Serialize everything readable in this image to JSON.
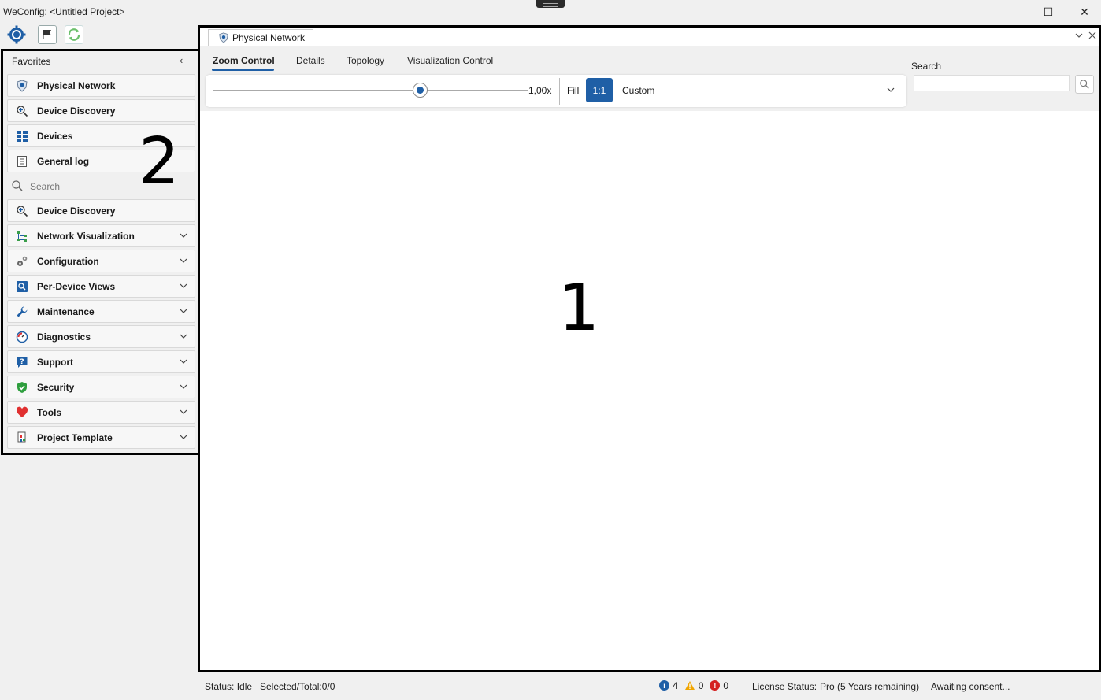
{
  "window": {
    "title": "WeConfig: <Untitled Project>",
    "min": "—",
    "max": "☐",
    "close": "✕"
  },
  "sidebar": {
    "favorites_header": "Favorites",
    "collapse": "‹",
    "favorites": [
      {
        "label": "Physical Network",
        "icon": "physical-network-icon"
      },
      {
        "label": "Device Discovery",
        "icon": "device-discovery-icon"
      },
      {
        "label": "Devices",
        "icon": "devices-icon"
      },
      {
        "label": "General log",
        "icon": "general-log-icon"
      }
    ],
    "search_placeholder": "Search",
    "sections": [
      {
        "label": "Device Discovery",
        "icon": "device-discovery-icon",
        "expandable": false
      },
      {
        "label": "Network Visualization",
        "icon": "network-visualization-icon",
        "expandable": true
      },
      {
        "label": "Configuration",
        "icon": "gears-icon",
        "expandable": true
      },
      {
        "label": "Per-Device Views",
        "icon": "per-device-views-icon",
        "expandable": true
      },
      {
        "label": "Maintenance",
        "icon": "wrench-icon",
        "expandable": true
      },
      {
        "label": "Diagnostics",
        "icon": "gauge-icon",
        "expandable": true
      },
      {
        "label": "Support",
        "icon": "help-icon",
        "expandable": true
      },
      {
        "label": "Security",
        "icon": "shield-icon",
        "expandable": true
      },
      {
        "label": "Tools",
        "icon": "heart-icon",
        "expandable": true
      },
      {
        "label": "Project Template",
        "icon": "template-icon",
        "expandable": true
      }
    ],
    "annotation": "2"
  },
  "main": {
    "doc_tab": "Physical Network",
    "ribbon_tabs": [
      "Zoom Control",
      "Details",
      "Topology",
      "Visualization Control"
    ],
    "active_tab": "Zoom Control",
    "zoom": {
      "value_label": "1,00x",
      "level": 1.0,
      "fill": "Fill",
      "one_to_one": "1:1",
      "custom": "Custom"
    },
    "search_label": "Search",
    "annotation": "1"
  },
  "status": {
    "status": "Status: Idle",
    "selected": "Selected/Total:0/0",
    "info_count": "4",
    "warning_count": "0",
    "error_count": "0",
    "license_label": "License Status:",
    "license_value": "Pro (5 Years remaining)",
    "consent": "Awaiting consent..."
  },
  "colors": {
    "accent": "#1f5fa6",
    "info": "#1f5fa6",
    "warning": "#f0a500",
    "error": "#d42020",
    "security": "#2e9e3e",
    "tools": "#e03030"
  }
}
